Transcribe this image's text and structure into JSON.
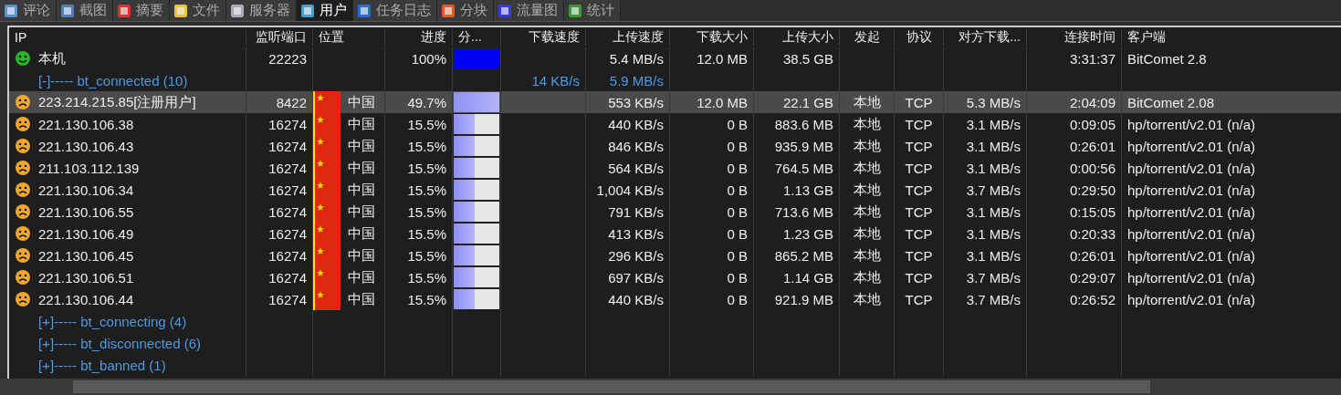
{
  "tabs": [
    {
      "label": "评论",
      "selected": false
    },
    {
      "label": "截图",
      "selected": false
    },
    {
      "label": "摘要",
      "selected": false
    },
    {
      "label": "文件",
      "selected": false
    },
    {
      "label": "服务器",
      "selected": false
    },
    {
      "label": "用户",
      "selected": true
    },
    {
      "label": "任务日志",
      "selected": false
    },
    {
      "label": "分块",
      "selected": false
    },
    {
      "label": "流量图",
      "selected": false
    },
    {
      "label": "统计",
      "selected": false
    }
  ],
  "table": {
    "columns": [
      "IP",
      "监听端口",
      "位置",
      "进度",
      "分...",
      "下载速度",
      "上传速度",
      "下载大小",
      "上传大小",
      "发起",
      "协议",
      "对方下载...",
      "连接时间",
      "客户端"
    ],
    "rows": [
      {
        "kind": "local",
        "selected": false,
        "ip": "本机",
        "port": "22223",
        "location": "",
        "progress": "100%",
        "level": 1,
        "dl_speed": "",
        "ul_speed": "5.4 MB/s",
        "dl_size": "12.0 MB",
        "ul_size": "38.5 GB",
        "initiated": "",
        "protocol": "",
        "peer_dl": "",
        "time": "3:31:37",
        "client": "BitComet 2.8"
      },
      {
        "kind": "group",
        "label": "[-]----- bt_connected (10)",
        "dl_speed": "14 KB/s",
        "ul_speed": "5.9 MB/s"
      },
      {
        "kind": "peer",
        "selected": true,
        "ip": "223.214.215.85[注册用户]",
        "port": "8422",
        "location": "中国",
        "progress": "49.7%",
        "level": 1,
        "dl_speed": "",
        "ul_speed": "553 KB/s",
        "dl_size": "12.0 MB",
        "ul_size": "22.1 GB",
        "initiated": "本地",
        "protocol": "TCP",
        "peer_dl": "5.3 MB/s",
        "time": "2:04:09",
        "client": "BitComet 2.08"
      },
      {
        "kind": "peer",
        "selected": false,
        "ip": "221.130.106.38",
        "port": "16274",
        "location": "中国",
        "progress": "15.5%",
        "level": 0.45,
        "dl_speed": "",
        "ul_speed": "440 KB/s",
        "dl_size": "0 B",
        "ul_size": "883.6 MB",
        "initiated": "本地",
        "protocol": "TCP",
        "peer_dl": "3.1 MB/s",
        "time": "0:09:05",
        "client": "hp/torrent/v2.01 (n/a)"
      },
      {
        "kind": "peer",
        "selected": false,
        "ip": "221.130.106.43",
        "port": "16274",
        "location": "中国",
        "progress": "15.5%",
        "level": 0.45,
        "dl_speed": "",
        "ul_speed": "846 KB/s",
        "dl_size": "0 B",
        "ul_size": "935.9 MB",
        "initiated": "本地",
        "protocol": "TCP",
        "peer_dl": "3.1 MB/s",
        "time": "0:26:01",
        "client": "hp/torrent/v2.01 (n/a)"
      },
      {
        "kind": "peer",
        "selected": false,
        "ip": "211.103.112.139",
        "port": "16274",
        "location": "中国",
        "progress": "15.5%",
        "level": 0.45,
        "dl_speed": "",
        "ul_speed": "564 KB/s",
        "dl_size": "0 B",
        "ul_size": "764.5 MB",
        "initiated": "本地",
        "protocol": "TCP",
        "peer_dl": "3.1 MB/s",
        "time": "0:00:56",
        "client": "hp/torrent/v2.01 (n/a)"
      },
      {
        "kind": "peer",
        "selected": false,
        "ip": "221.130.106.34",
        "port": "16274",
        "location": "中国",
        "progress": "15.5%",
        "level": 0.45,
        "dl_speed": "",
        "ul_speed": "1,004 KB/s",
        "dl_size": "0 B",
        "ul_size": "1.13 GB",
        "initiated": "本地",
        "protocol": "TCP",
        "peer_dl": "3.7 MB/s",
        "time": "0:29:50",
        "client": "hp/torrent/v2.01 (n/a)"
      },
      {
        "kind": "peer",
        "selected": false,
        "ip": "221.130.106.55",
        "port": "16274",
        "location": "中国",
        "progress": "15.5%",
        "level": 0.45,
        "dl_speed": "",
        "ul_speed": "791 KB/s",
        "dl_size": "0 B",
        "ul_size": "713.6 MB",
        "initiated": "本地",
        "protocol": "TCP",
        "peer_dl": "3.1 MB/s",
        "time": "0:15:05",
        "client": "hp/torrent/v2.01 (n/a)"
      },
      {
        "kind": "peer",
        "selected": false,
        "ip": "221.130.106.49",
        "port": "16274",
        "location": "中国",
        "progress": "15.5%",
        "level": 0.45,
        "dl_speed": "",
        "ul_speed": "413 KB/s",
        "dl_size": "0 B",
        "ul_size": "1.23 GB",
        "initiated": "本地",
        "protocol": "TCP",
        "peer_dl": "3.1 MB/s",
        "time": "0:20:33",
        "client": "hp/torrent/v2.01 (n/a)"
      },
      {
        "kind": "peer",
        "selected": false,
        "ip": "221.130.106.45",
        "port": "16274",
        "location": "中国",
        "progress": "15.5%",
        "level": 0.45,
        "dl_speed": "",
        "ul_speed": "296 KB/s",
        "dl_size": "0 B",
        "ul_size": "865.2 MB",
        "initiated": "本地",
        "protocol": "TCP",
        "peer_dl": "3.1 MB/s",
        "time": "0:26:01",
        "client": "hp/torrent/v2.01 (n/a)"
      },
      {
        "kind": "peer",
        "selected": false,
        "ip": "221.130.106.51",
        "port": "16274",
        "location": "中国",
        "progress": "15.5%",
        "level": 0.45,
        "dl_speed": "",
        "ul_speed": "697 KB/s",
        "dl_size": "0 B",
        "ul_size": "1.14 GB",
        "initiated": "本地",
        "protocol": "TCP",
        "peer_dl": "3.7 MB/s",
        "time": "0:29:07",
        "client": "hp/torrent/v2.01 (n/a)"
      },
      {
        "kind": "peer",
        "selected": false,
        "ip": "221.130.106.44",
        "port": "16274",
        "location": "中国",
        "progress": "15.5%",
        "level": 0.45,
        "dl_speed": "",
        "ul_speed": "440 KB/s",
        "dl_size": "0 B",
        "ul_size": "921.9 MB",
        "initiated": "本地",
        "protocol": "TCP",
        "peer_dl": "3.7 MB/s",
        "time": "0:26:52",
        "client": "hp/torrent/v2.01 (n/a)"
      },
      {
        "kind": "group",
        "label": "[+]----- bt_connecting (4)",
        "dl_speed": "",
        "ul_speed": ""
      },
      {
        "kind": "group",
        "label": "[+]----- bt_disconnected (6)",
        "dl_speed": "",
        "ul_speed": ""
      },
      {
        "kind": "group",
        "label": "[+]----- bt_banned (1)",
        "dl_speed": "",
        "ul_speed": ""
      }
    ]
  }
}
